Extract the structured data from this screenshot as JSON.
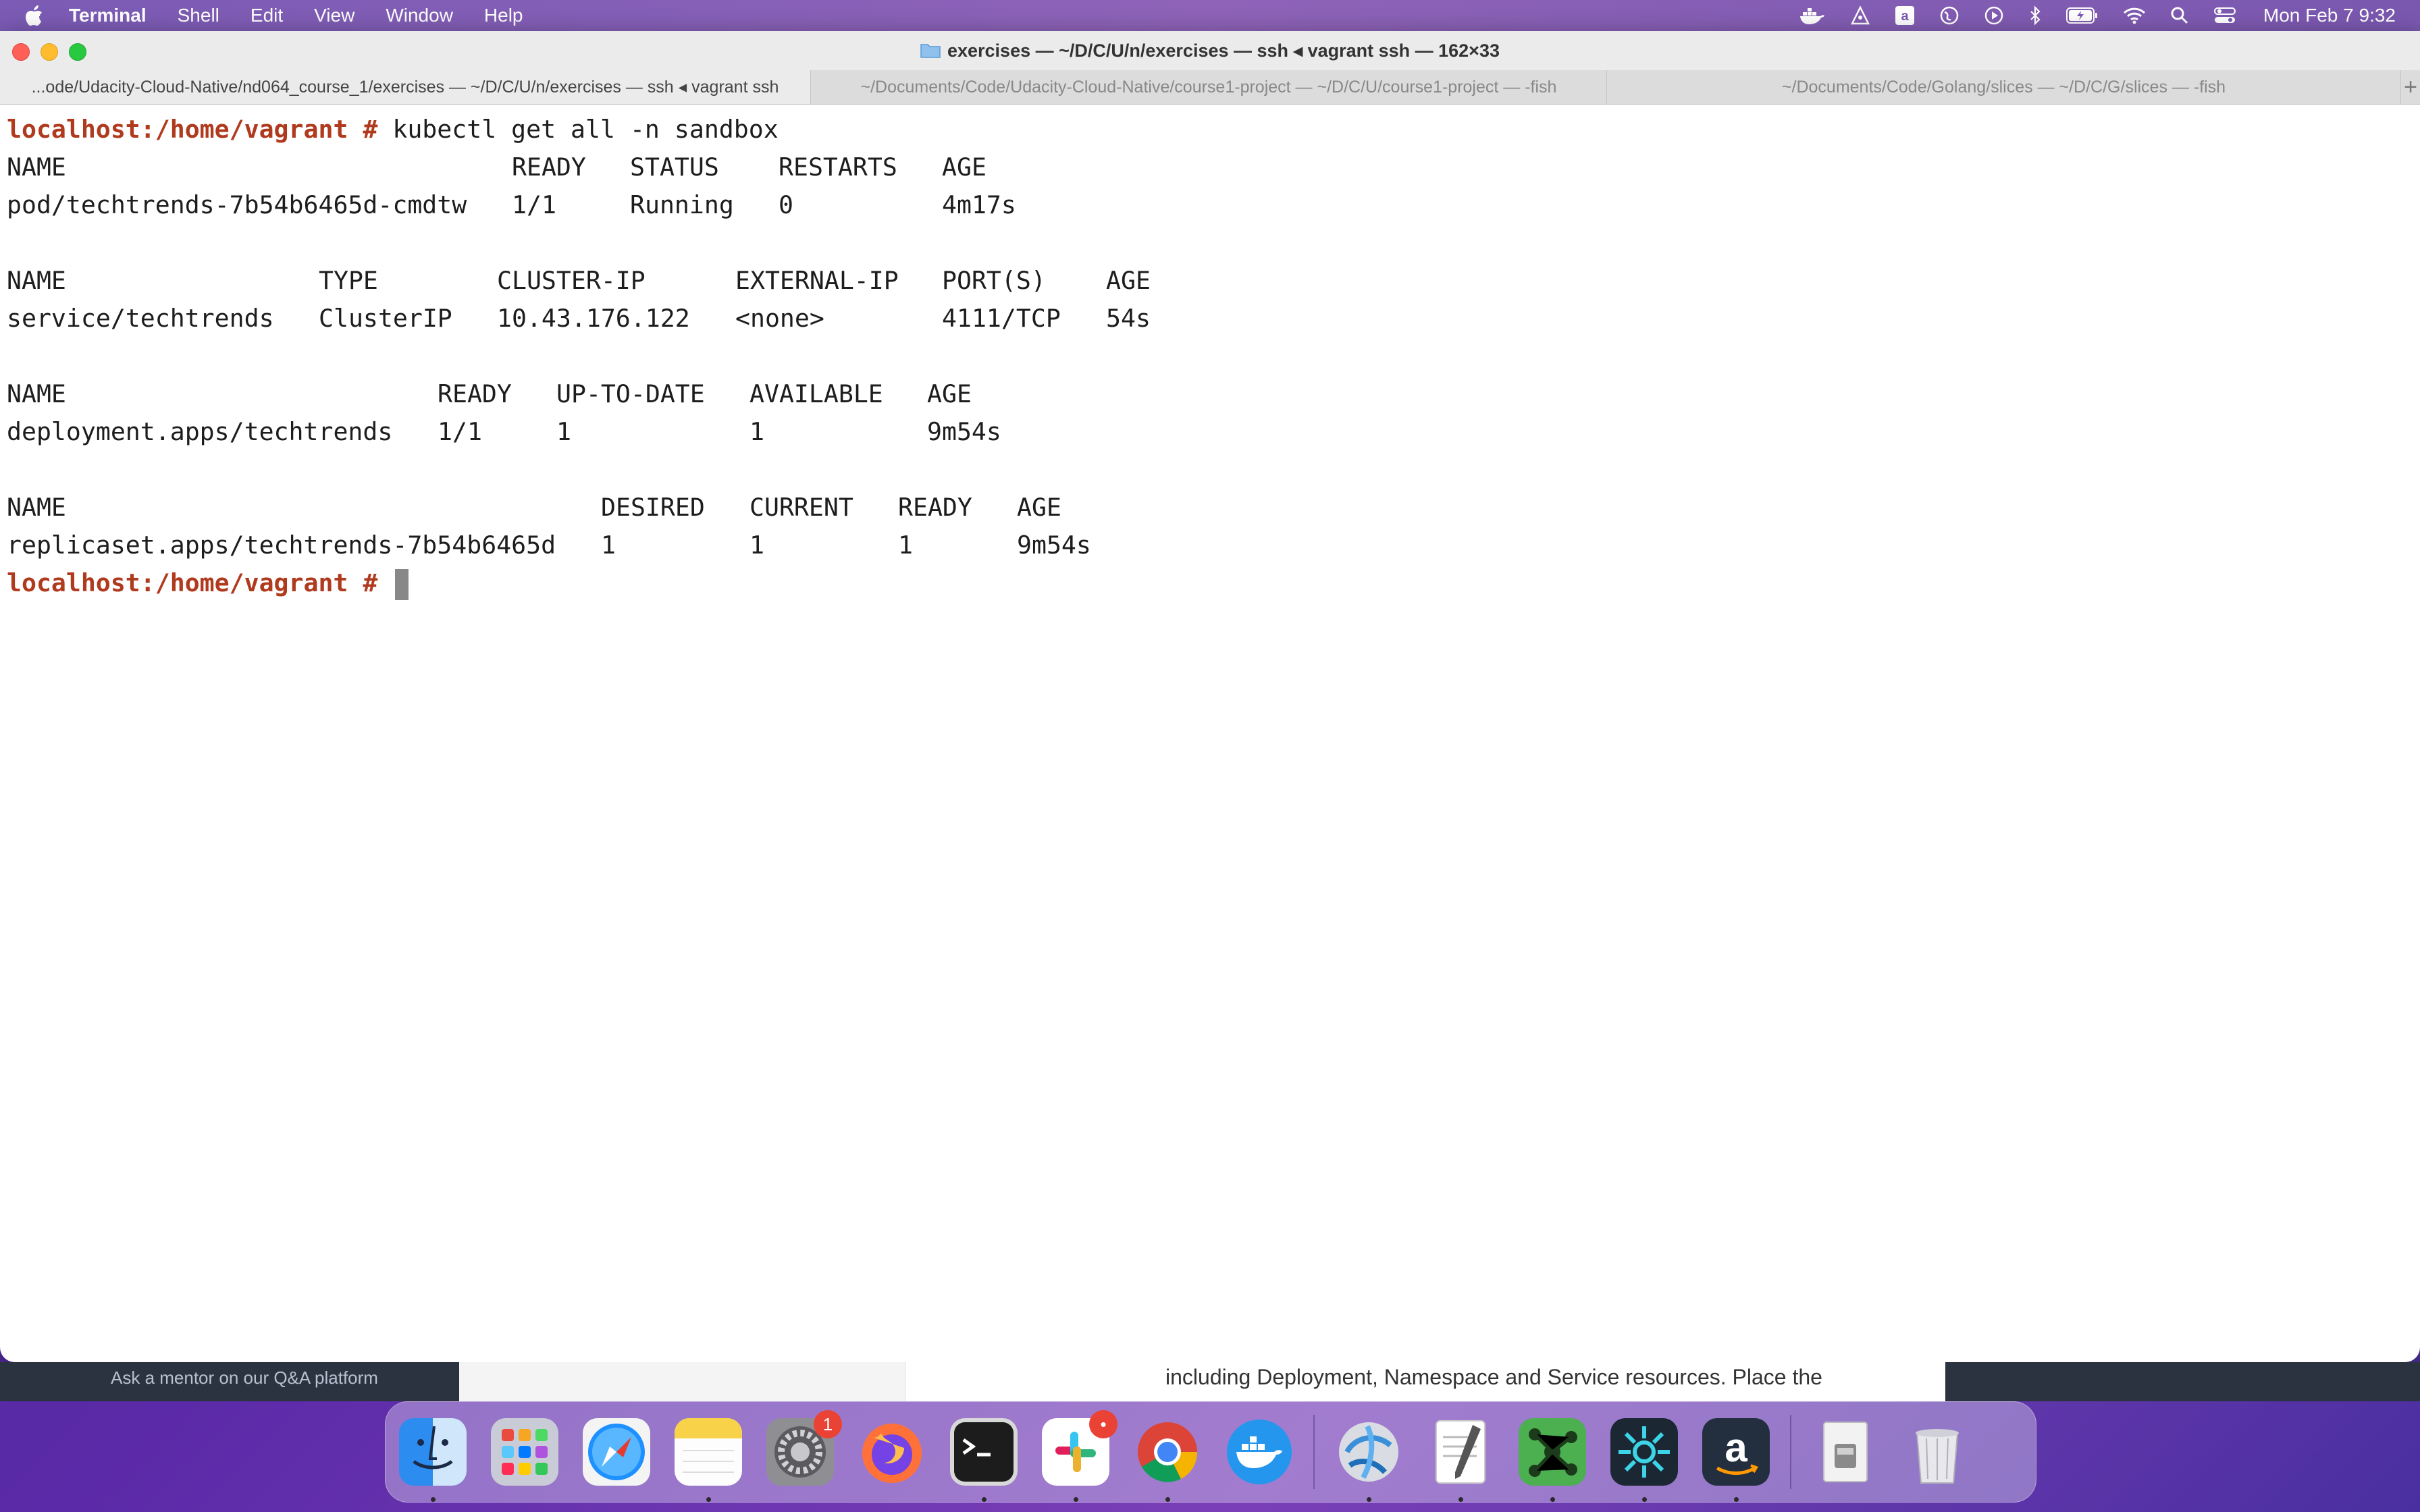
{
  "menubar": {
    "app": "Terminal",
    "items": [
      "Shell",
      "Edit",
      "View",
      "Window",
      "Help"
    ],
    "clock": "Mon Feb 7  9:32"
  },
  "window": {
    "title": "exercises — ~/D/C/U/n/exercises — ssh ◂ vagrant ssh — 162×33",
    "tabs": [
      "...ode/Udacity-Cloud-Native/nd064_course_1/exercises — ~/D/C/U/n/exercises — ssh ◂ vagrant ssh",
      "~/Documents/Code/Udacity-Cloud-Native/course1-project — ~/D/C/U/course1-project — -fish",
      "~/Documents/Code/Golang/slices — ~/D/C/G/slices — -fish"
    ],
    "new_tab": "+"
  },
  "terminal": {
    "prompt": "localhost:/home/vagrant #",
    "command": "kubectl get all -n sandbox",
    "pods": {
      "headers": [
        "NAME",
        "READY",
        "STATUS",
        "RESTARTS",
        "AGE"
      ],
      "row": [
        "pod/techtrends-7b54b6465d-cmdtw",
        "1/1",
        "Running",
        "0",
        "4m17s"
      ]
    },
    "services": {
      "headers": [
        "NAME",
        "TYPE",
        "CLUSTER-IP",
        "EXTERNAL-IP",
        "PORT(S)",
        "AGE"
      ],
      "row": [
        "service/techtrends",
        "ClusterIP",
        "10.43.176.122",
        "<none>",
        "4111/TCP",
        "54s"
      ]
    },
    "deployments": {
      "headers": [
        "NAME",
        "READY",
        "UP-TO-DATE",
        "AVAILABLE",
        "AGE"
      ],
      "row": [
        "deployment.apps/techtrends",
        "1/1",
        "1",
        "1",
        "9m54s"
      ]
    },
    "replicasets": {
      "headers": [
        "NAME",
        "DESIRED",
        "CURRENT",
        "READY",
        "AGE"
      ],
      "row": [
        "replicaset.apps/techtrends-7b54b6465d",
        "1",
        "1",
        "1",
        "9m54s"
      ]
    }
  },
  "background": {
    "mentor_text": "Ask a mentor on our Q&A platform",
    "page_text": "including Deployment, Namespace and Service resources. Place the"
  },
  "dock": {
    "badges": {
      "system_preferences": "1",
      "slack": "•"
    }
  }
}
